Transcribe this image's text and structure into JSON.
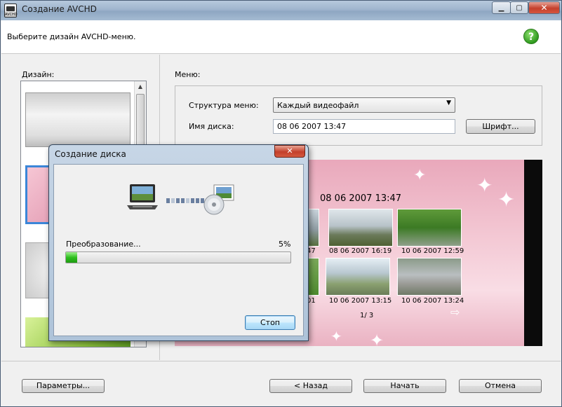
{
  "window": {
    "title": "Создание AVCHD",
    "app_icon_text": "AVCHD",
    "controls": {
      "minimize": "▁",
      "maximize": "▢",
      "close": "✕"
    }
  },
  "header": {
    "instruction": "Выберите дизайн AVCHD-меню.",
    "help_symbol": "?"
  },
  "design": {
    "label": "Дизайн:",
    "thumbnails": [
      "silver",
      "pink-floral",
      "gray-swirl",
      "green"
    ],
    "selected_index": 1
  },
  "menu": {
    "label": "Меню:",
    "structure_label": "Структура меню:",
    "structure_value": "Каждый видеофайл",
    "disc_name_label": "Имя диска:",
    "disc_name_value": "08 06 2007  13:47",
    "font_button": "Шрифт..."
  },
  "preview": {
    "title": "08 06 2007  13:47",
    "items": [
      {
        "caption": "08 06 2007  16:19"
      },
      {
        "caption": "10 06 2007  12:59"
      },
      {
        "caption": "10 06 2007  13:15"
      },
      {
        "caption": "10 06 2007  13:24"
      }
    ],
    "partial_captions": [
      "47",
      "01"
    ],
    "page": "1/  3",
    "next_arrow": "⇨"
  },
  "footer": {
    "params_button": "Параметры...",
    "back_button": "< Назад",
    "start_button": "Начать",
    "cancel_button": "Отмена"
  },
  "dialog": {
    "title": "Создание диска",
    "close_symbol": "✕",
    "progress_label": "Преобразование...",
    "progress_percent_text": "5%",
    "progress_value": 0.05,
    "stop_button": "Стоп"
  },
  "colors": {
    "accent": "#3b86d8",
    "progress": "#2fbf1f",
    "close": "#c5402c"
  }
}
